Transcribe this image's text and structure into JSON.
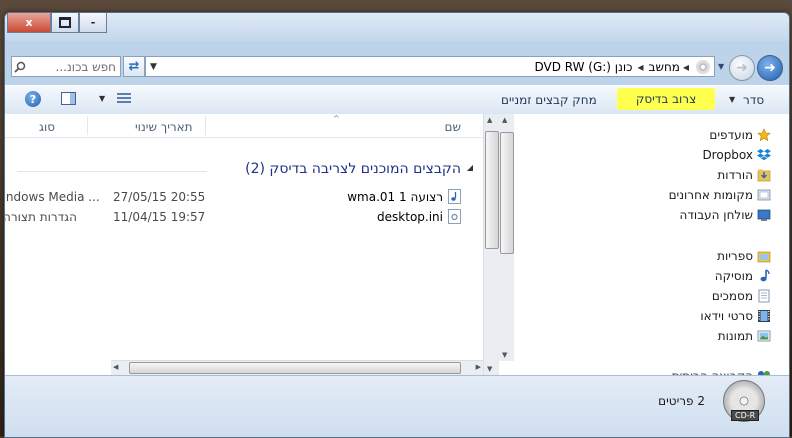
{
  "window": {
    "close_label": "x",
    "restore_label": "",
    "minimize_label": "-"
  },
  "address": {
    "path": [
      "מחשב",
      "כונן DVD RW (G:)"
    ],
    "search_placeholder": "חפש בכונ..."
  },
  "toolbar": {
    "organize": "סדר",
    "burn": "צרוב בדיסק",
    "delete_temp": "מחק קבצים זמניים"
  },
  "nav": {
    "favorites": "מועדפים",
    "favorites_items": [
      "Dropbox",
      "הורדות",
      "מקומות אחרונים",
      "שולחן העבודה"
    ],
    "libraries": "ספריות",
    "libraries_items": [
      "מוסיקה",
      "מסמכים",
      "סרטי וידאו",
      "תמונות"
    ],
    "partial": "הקבוצה הביתית"
  },
  "columns": {
    "name": "שם",
    "modified": "תאריך שינוי",
    "type": "סוג"
  },
  "group": {
    "title": "הקבצים המוכנים לצריבה בדיסק (2)"
  },
  "files": [
    {
      "name": "רצועה 1 01.wma",
      "modified": "27/05/15 20:55",
      "type": "Windows Media ...",
      "icon": "audio-file-icon"
    },
    {
      "name": "desktop.ini",
      "modified": "11/04/15 19:57",
      "type": "הגדרות תצורה",
      "icon": "settings-file-icon"
    }
  ],
  "status": {
    "count": "2 פריטים",
    "disc_label": "CD-R"
  },
  "colors": {
    "highlight": "#ffff4d",
    "group_title": "#1e3287",
    "accent": "#2f6db6"
  }
}
